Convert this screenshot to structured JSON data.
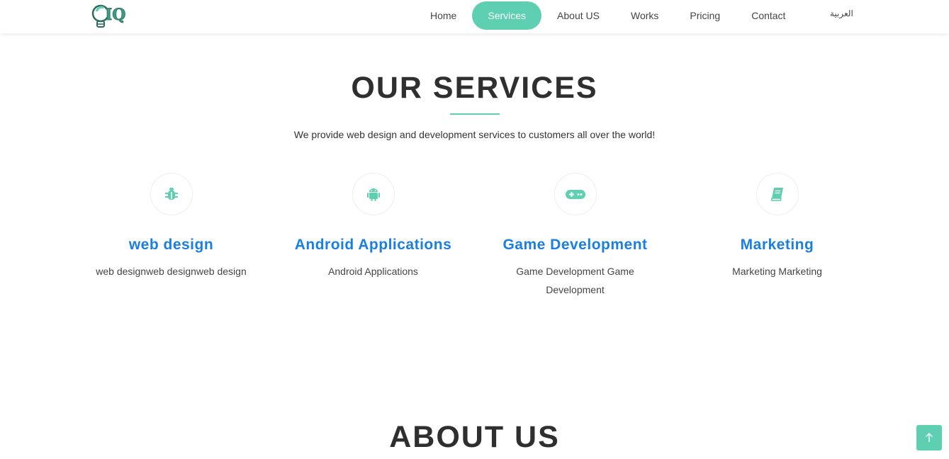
{
  "nav": {
    "logo_alt": "IQ",
    "items": [
      {
        "label": "Home",
        "active": false
      },
      {
        "label": "Services",
        "active": true
      },
      {
        "label": "About US",
        "active": false
      },
      {
        "label": "Works",
        "active": false
      },
      {
        "label": "Pricing",
        "active": false
      },
      {
        "label": "Contact",
        "active": false
      }
    ],
    "language": "العربية"
  },
  "services_section": {
    "title": "OUR SERVICES",
    "subtitle": "We provide web design and development services to customers all over the world!",
    "items": [
      {
        "icon": "bug-icon",
        "title": "web design",
        "description": "web designweb designweb design"
      },
      {
        "icon": "android-icon",
        "title": "Android Applications",
        "description": "Android Applications"
      },
      {
        "icon": "gamepad-icon",
        "title": "Game Development",
        "description": "Game Development Game Development"
      },
      {
        "icon": "book-icon",
        "title": "Marketing",
        "description": "Marketing Marketing"
      }
    ]
  },
  "about_section": {
    "title": "ABOUT US"
  },
  "colors": {
    "accent": "#5fcfb1",
    "link_blue": "#1a7fe0",
    "heading": "#2f2f2f"
  }
}
